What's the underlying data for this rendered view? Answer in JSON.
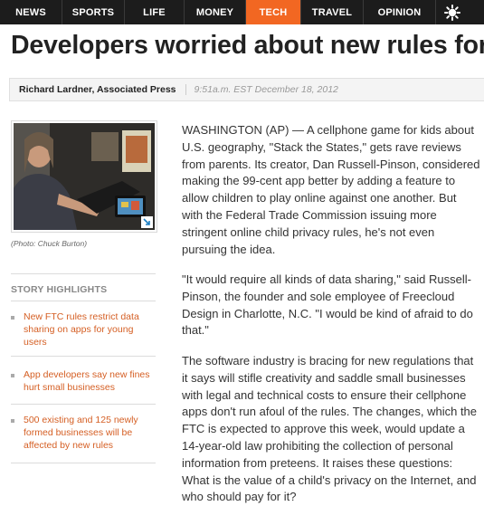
{
  "nav": {
    "items": [
      "NEWS",
      "SPORTS",
      "LIFE",
      "MONEY",
      "TECH",
      "TRAVEL",
      "OPINION"
    ],
    "active": "TECH",
    "accent_color": "#f26722",
    "settings_icon": "sun-gear-icon"
  },
  "article": {
    "headline": "Developers worried about new rules for",
    "author": "Richard Lardner, Associated Press",
    "timestamp": "9:51a.m. EST December 18, 2012",
    "photo_caption": "(Photo: Chuck Burton)",
    "paragraphs": [
      "WASHINGTON (AP) — A cellphone game for kids about U.S. geography, \"Stack the States,\" gets rave reviews from parents. Its creator, Dan Russell-Pinson, considered making the 99-cent app better by adding a feature to allow children to play online against one another. But with the Federal Trade Commission issuing more stringent online child privacy rules, he's not even pursuing the idea.",
      "\"It would require all kinds of data sharing,\" said Russell-Pinson, the founder and sole employee of Freecloud Design in Charlotte, N.C. \"I would be kind of afraid to do that.\"",
      "The software industry is bracing for new regulations that it says will stifle creativity and saddle small businesses with legal and technical costs to ensure their cellphone apps don't run afoul of the rules. The changes, which the FTC is expected to approve this week, would update a 14-year-old law prohibiting the collection of personal information from preteens. It raises these questions: What is the value of a child's privacy on the Internet, and who should pay for it?"
    ]
  },
  "highlights": {
    "title": "STORY HIGHLIGHTS",
    "items": [
      "New FTC rules restrict data sharing on apps for young users",
      "App developers say new fines hurt small businesses",
      "500 existing and 125 newly formed businesses will be affected by new rules"
    ]
  }
}
